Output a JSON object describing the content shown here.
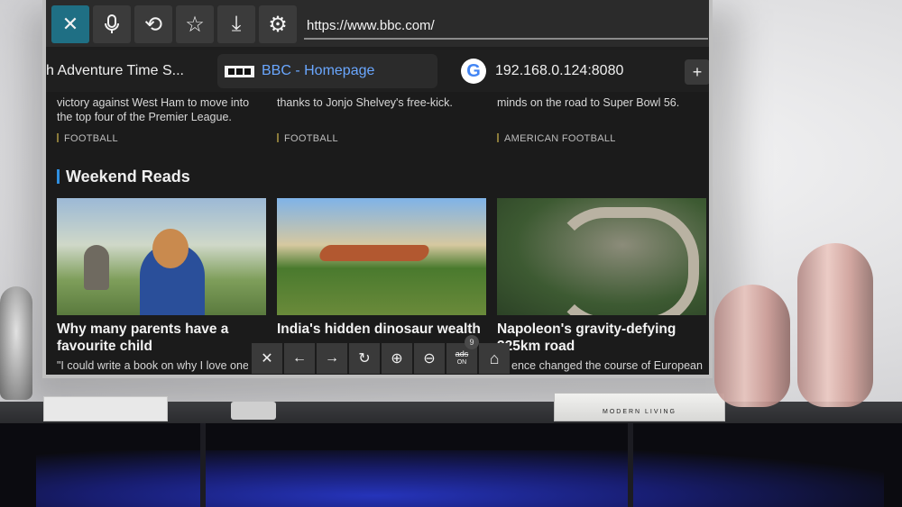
{
  "toolbar": {
    "buttons": [
      {
        "name": "close",
        "glyph": "✕"
      },
      {
        "name": "voice",
        "glyph": "🎙"
      },
      {
        "name": "history",
        "glyph": "⟲"
      },
      {
        "name": "bookmark",
        "glyph": "☆"
      },
      {
        "name": "download",
        "glyph": "⤓"
      },
      {
        "name": "settings",
        "glyph": "⚙"
      }
    ],
    "url": "https://www.bbc.com/"
  },
  "tabs": {
    "items": [
      {
        "label": "h Adventure Time S..."
      },
      {
        "label": "BBC - Homepage"
      },
      {
        "label": "192.168.0.124:8080"
      }
    ],
    "google_glyph": "G",
    "add_glyph": "+"
  },
  "content": {
    "top_snippets": [
      {
        "text": "victory against West Ham to move into the top four of the Premier League.",
        "tag": "FOOTBALL"
      },
      {
        "text": "thanks to Jonjo Shelvey's free-kick.",
        "tag": "FOOTBALL"
      },
      {
        "text": "minds on the road to Super Bowl 56.",
        "tag": "AMERICAN FOOTBALL"
      }
    ],
    "section_title": "Weekend Reads",
    "cards": [
      {
        "title": "Why many parents have a favourite child",
        "sub": "\"I could write a book on why I love one"
      },
      {
        "title": "India's hidden dinosaur wealth",
        "sub": ""
      },
      {
        "title": "Napoleon's gravity-defying 325km road",
        "sub": "ence changed the course of European"
      }
    ]
  },
  "nav": {
    "buttons": [
      {
        "name": "close",
        "glyph": "✕"
      },
      {
        "name": "back",
        "glyph": "←"
      },
      {
        "name": "forward",
        "glyph": "→"
      },
      {
        "name": "reload",
        "glyph": "↻"
      },
      {
        "name": "zoom-in",
        "glyph": "⊕"
      },
      {
        "name": "zoom-out",
        "glyph": "⊖"
      },
      {
        "name": "ads",
        "label": "ads",
        "state": "ON",
        "count": "9"
      },
      {
        "name": "home",
        "glyph": "⌂"
      }
    ]
  },
  "room": {
    "book_label": "MODERN LIVING"
  },
  "colors": {
    "accent": "#1f6f84",
    "section_bar": "#2f8fe0",
    "link_text": "#6aa7ff"
  }
}
